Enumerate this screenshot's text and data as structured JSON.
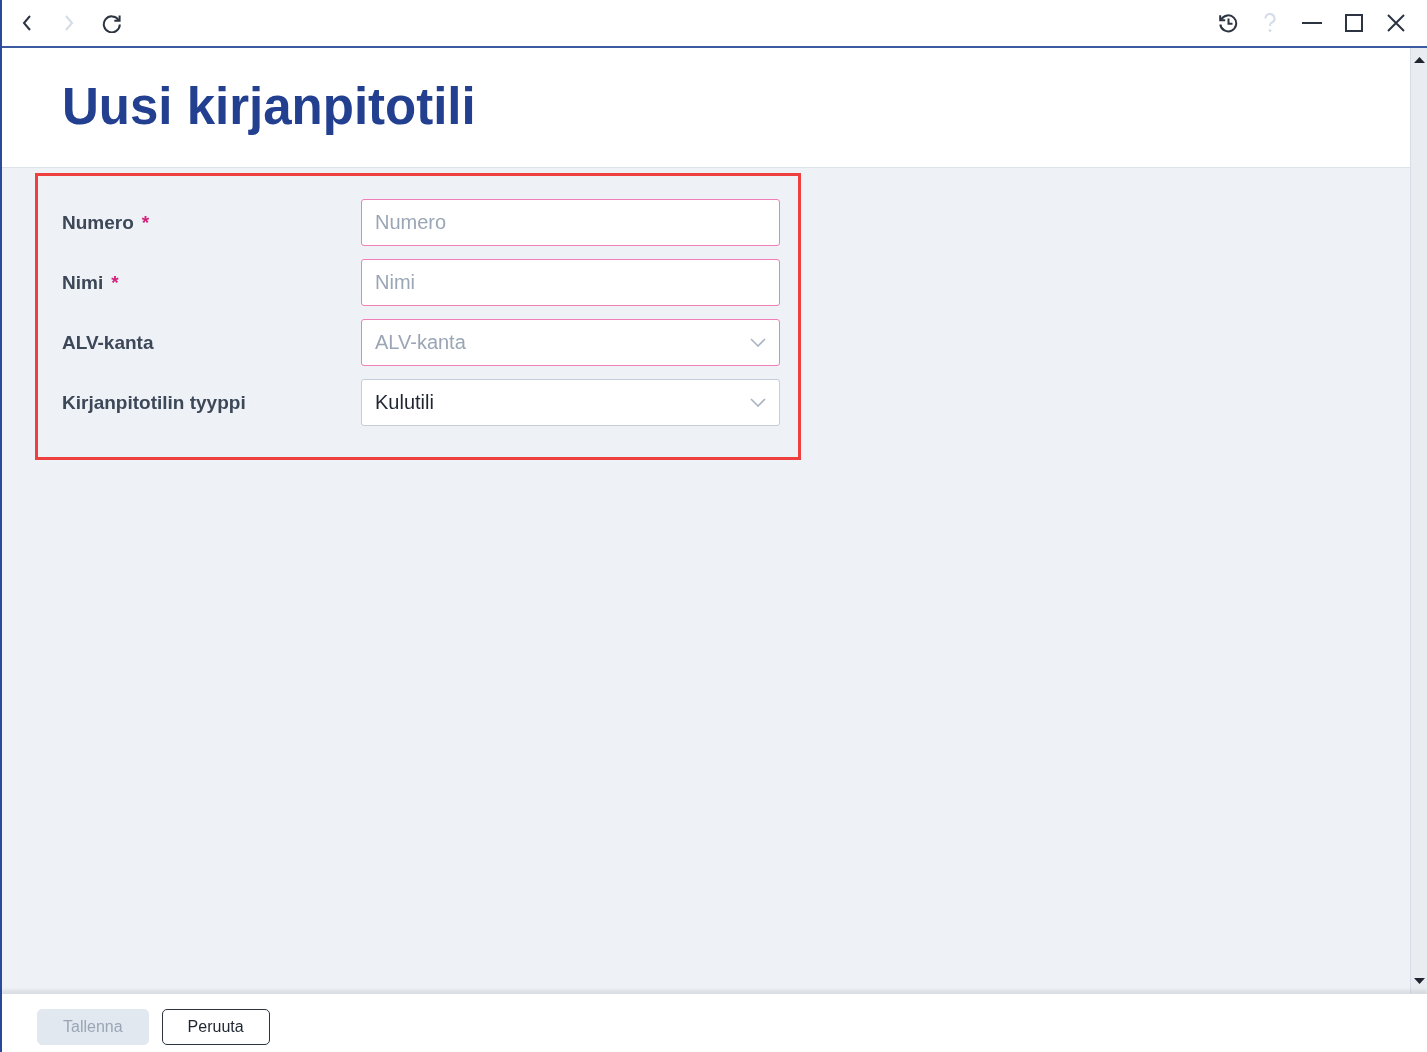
{
  "toolbar": {
    "nav_buttons": [
      {
        "kind": "back",
        "disabled": false
      },
      {
        "kind": "forward",
        "disabled": true
      },
      {
        "kind": "reload",
        "disabled": false
      }
    ],
    "window_buttons": [
      {
        "kind": "history",
        "disabled": false
      },
      {
        "kind": "help",
        "disabled": true
      },
      {
        "kind": "minimize",
        "disabled": false
      },
      {
        "kind": "maximize",
        "disabled": false
      },
      {
        "kind": "close",
        "disabled": false
      }
    ]
  },
  "page": {
    "title": "Uusi kirjanpitotili"
  },
  "form": {
    "highlighted": true,
    "fields": [
      {
        "kind": "text",
        "label": "Numero",
        "required_mark": "*",
        "placeholder": "Numero",
        "invalid": true
      },
      {
        "kind": "text",
        "label": "Nimi",
        "required_mark": "*",
        "placeholder": "Nimi",
        "invalid": true
      },
      {
        "kind": "select",
        "label": "ALV-kanta",
        "placeholder": "ALV-kanta",
        "invalid": true
      },
      {
        "kind": "select",
        "label": "Kirjanpitotilin tyyppi",
        "value": "Kulutili",
        "invalid": false
      }
    ]
  },
  "footer": {
    "buttons": [
      {
        "kind": "primary",
        "label": "Tallenna",
        "disabled": true
      },
      {
        "kind": "secondary",
        "label": "Peruuta",
        "disabled": false
      }
    ]
  }
}
